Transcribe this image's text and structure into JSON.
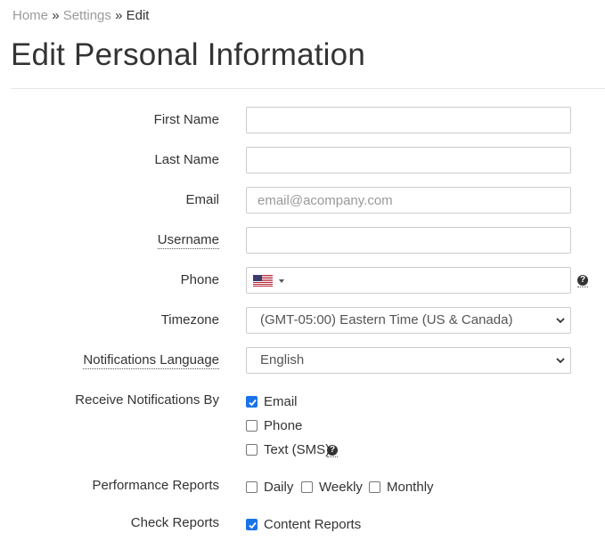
{
  "breadcrumb": {
    "home": "Home",
    "settings": "Settings",
    "current": "Edit",
    "separator": "»"
  },
  "page": {
    "title": "Edit Personal Information"
  },
  "form": {
    "first_name": {
      "label": "First Name",
      "value": ""
    },
    "last_name": {
      "label": "Last Name",
      "value": ""
    },
    "email": {
      "label": "Email",
      "value": "",
      "placeholder": "email@acompany.com"
    },
    "username": {
      "label": "Username",
      "value": ""
    },
    "phone": {
      "label": "Phone",
      "value": "",
      "country_flag": "us-flag-icon"
    },
    "timezone": {
      "label": "Timezone",
      "selected": "(GMT-05:00) Eastern Time (US & Canada)"
    },
    "notifications_language": {
      "label": "Notifications Language",
      "selected": "English"
    },
    "receive_notifications": {
      "label": "Receive Notifications By",
      "options": [
        {
          "label": "Email",
          "checked": true
        },
        {
          "label": "Phone",
          "checked": false
        },
        {
          "label": "Text (SMS)",
          "checked": false
        }
      ]
    },
    "performance_reports": {
      "label": "Performance Reports",
      "options": [
        {
          "label": "Daily",
          "checked": false
        },
        {
          "label": "Weekly",
          "checked": false
        },
        {
          "label": "Monthly",
          "checked": false
        }
      ]
    },
    "check_reports": {
      "label": "Check Reports",
      "options": [
        {
          "label": "Content Reports",
          "checked": true
        }
      ]
    }
  },
  "help_icon_text": "?",
  "colors": {
    "checkbox_checked": "#1a73e8",
    "border": "#cccccc",
    "muted_text": "#9b9b9b"
  }
}
